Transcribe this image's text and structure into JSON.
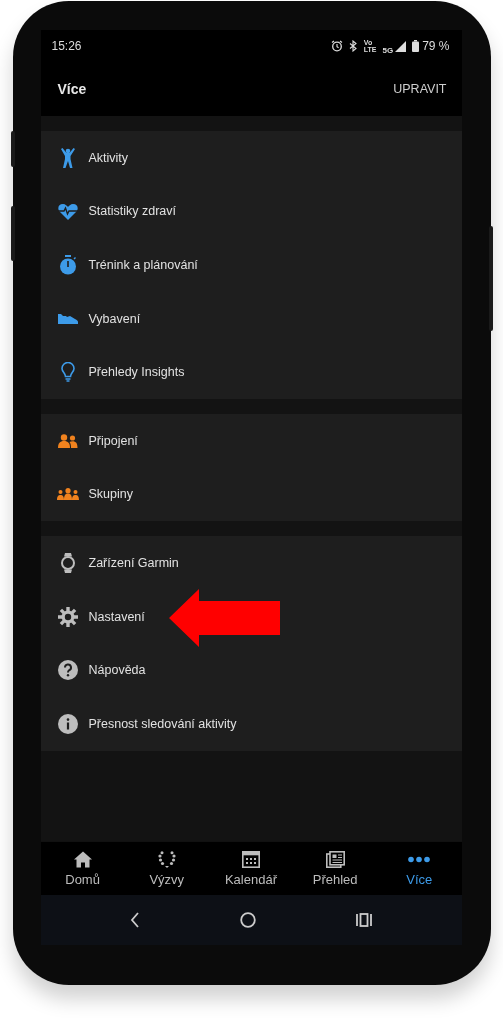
{
  "status_bar": {
    "time": "15:26",
    "network_top": "Vo",
    "network_bottom": "LTE",
    "network": "5G",
    "battery": "79 %"
  },
  "header": {
    "title": "Více",
    "action": "UPRAVIT"
  },
  "groups": [
    {
      "items": [
        {
          "label": "Aktivity",
          "kind": "figure",
          "color": "#3d9be9"
        },
        {
          "label": "Statistiky zdraví",
          "kind": "heart",
          "color": "#3d9be9"
        },
        {
          "label": "Trénink a plánování",
          "kind": "stopwatch",
          "color": "#3d9be9"
        },
        {
          "label": "Vybavení",
          "kind": "shoe",
          "color": "#3d9be9"
        },
        {
          "label": "Přehledy Insights",
          "kind": "bulb",
          "color": "#3d9be9"
        }
      ]
    },
    {
      "items": [
        {
          "label": "Připojení",
          "kind": "people",
          "color": "#f0821e"
        },
        {
          "label": "Skupiny",
          "kind": "group",
          "color": "#f0821e"
        }
      ]
    },
    {
      "items": [
        {
          "label": "Zařízení Garmin",
          "kind": "watch",
          "color": "#bdbdbd"
        },
        {
          "label": "Nastavení",
          "kind": "gear",
          "color": "#bdbdbd"
        },
        {
          "label": "Nápověda",
          "kind": "help",
          "color": "#bdbdbd"
        },
        {
          "label": "Přesnost sledování aktivity",
          "kind": "info",
          "color": "#bdbdbd"
        }
      ]
    }
  ],
  "bottom_nav": [
    {
      "label": "Domů",
      "kind": "home",
      "selected": false
    },
    {
      "label": "Výzvy",
      "kind": "laurel",
      "selected": false
    },
    {
      "label": "Kalendář",
      "kind": "calendar",
      "selected": false
    },
    {
      "label": "Přehled",
      "kind": "news",
      "selected": false
    },
    {
      "label": "Více",
      "kind": "more",
      "selected": true
    }
  ],
  "system_nav": [
    {
      "kind": "back"
    },
    {
      "kind": "home"
    },
    {
      "kind": "recents"
    }
  ]
}
